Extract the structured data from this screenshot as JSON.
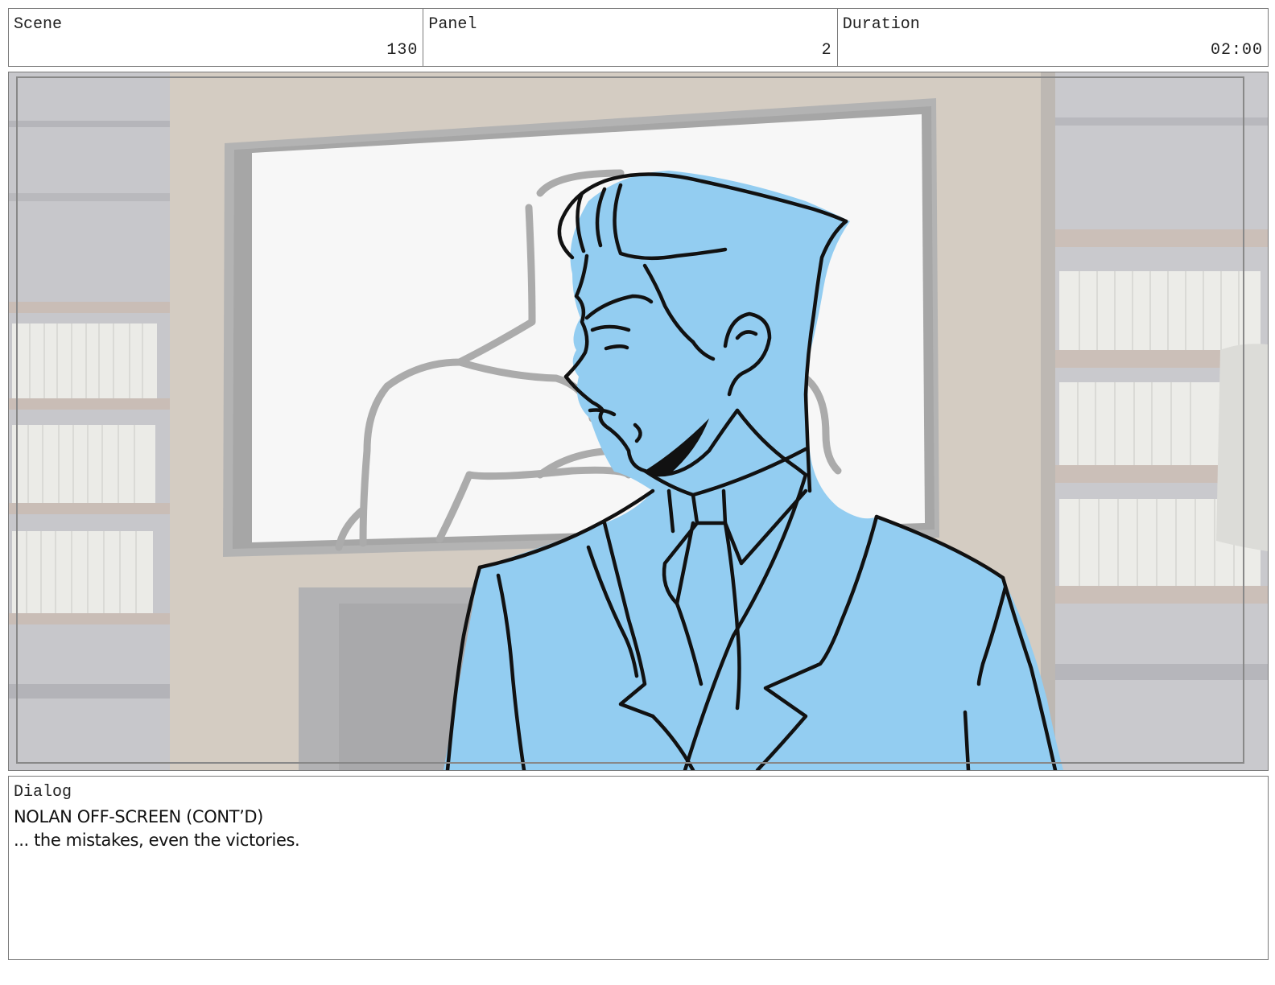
{
  "header": {
    "scene": {
      "label": "Scene",
      "value": "130"
    },
    "panel": {
      "label": "Panel",
      "value": "2"
    },
    "duration": {
      "label": "Duration",
      "value": "02:00"
    }
  },
  "frame": {
    "colors": {
      "background_wall": "#d4ccc2",
      "bookshelf": "#c9c9cc",
      "books": "#eeeeea",
      "monitor_screen": "#f7f7f7",
      "monitor_frame": "#a8a8a8",
      "character_fill": "#93cdf1",
      "ink": "#111111"
    }
  },
  "dialog": {
    "label": "Dialog",
    "lines": [
      "NOLAN OFF-SCREEN (CONT’D)",
      "... the mistakes, even the victories."
    ]
  }
}
